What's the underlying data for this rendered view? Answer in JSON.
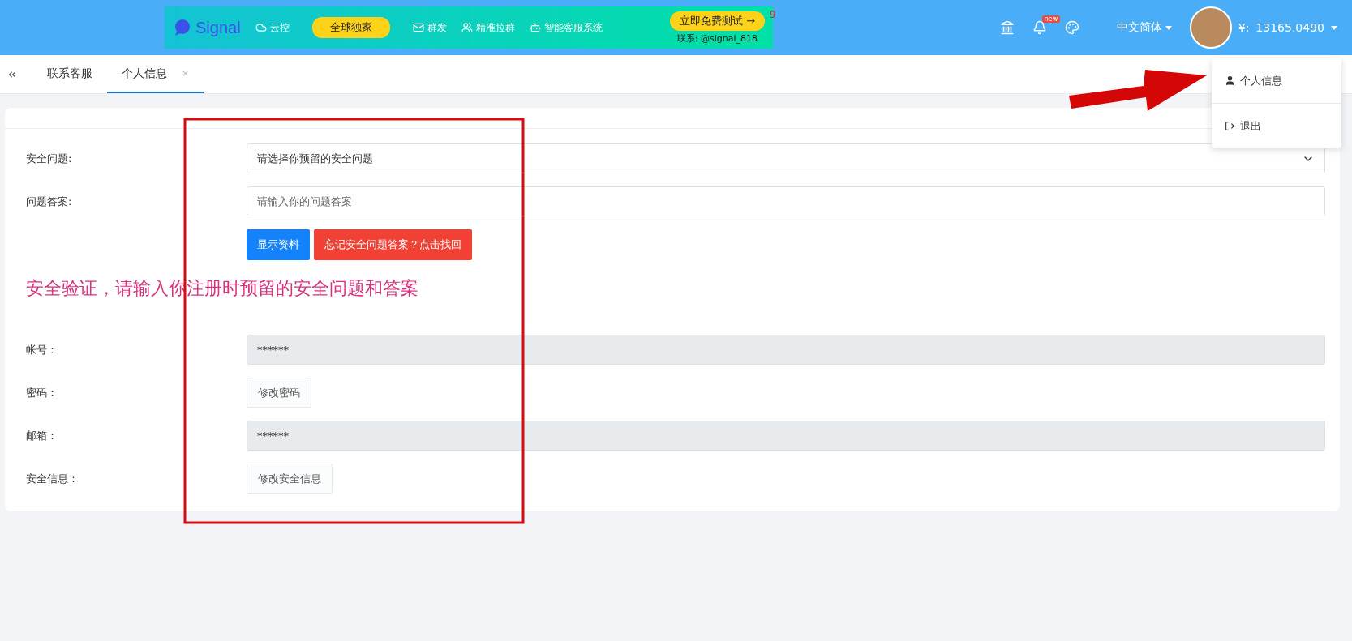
{
  "ad_banner": {
    "brand": "Signal",
    "items": [
      {
        "kind": "plain",
        "label": "云控"
      },
      {
        "kind": "pill",
        "label": "全球独家"
      },
      {
        "kind": "plain",
        "label": "群发"
      },
      {
        "kind": "plain",
        "label": "精准拉群"
      },
      {
        "kind": "plain",
        "label": "智能客服系统"
      }
    ],
    "cta": "立即免费测试 →",
    "cta_badge": "9",
    "contact": "联系: @signal_818"
  },
  "header": {
    "notification_badge": "new",
    "language": "中文简体",
    "currency": "¥:",
    "balance": "13165.0490"
  },
  "user_menu": {
    "items": [
      {
        "kind": "profile",
        "label": "个人信息"
      },
      {
        "kind": "logout",
        "label": "退出"
      }
    ]
  },
  "tabs": [
    {
      "label": "联系客服",
      "selected": false,
      "closable": false
    },
    {
      "label": "个人信息",
      "selected": true,
      "closable": true
    }
  ],
  "tab_close": "×",
  "security": {
    "question_label": "安全问题:",
    "question_placeholder": "请选择你预留的安全问题",
    "answer_label": "问题答案:",
    "answer_placeholder": "请输入你的问题答案",
    "buttons": [
      {
        "kind": "primary",
        "label": "显示资料"
      },
      {
        "kind": "danger",
        "label": "忘记安全问题答案？点击找回"
      }
    ],
    "notice": "安全验证，请输入你注册时预留的安全问题和答案"
  },
  "account_rows": [
    {
      "kind": "readonly",
      "label": "帐号：",
      "value": "******"
    },
    {
      "kind": "button",
      "label": "密码：",
      "value": "修改密码"
    },
    {
      "kind": "readonly",
      "label": "邮箱：",
      "value": "******"
    },
    {
      "kind": "button",
      "label": "安全信息：",
      "value": "修改安全信息"
    }
  ]
}
